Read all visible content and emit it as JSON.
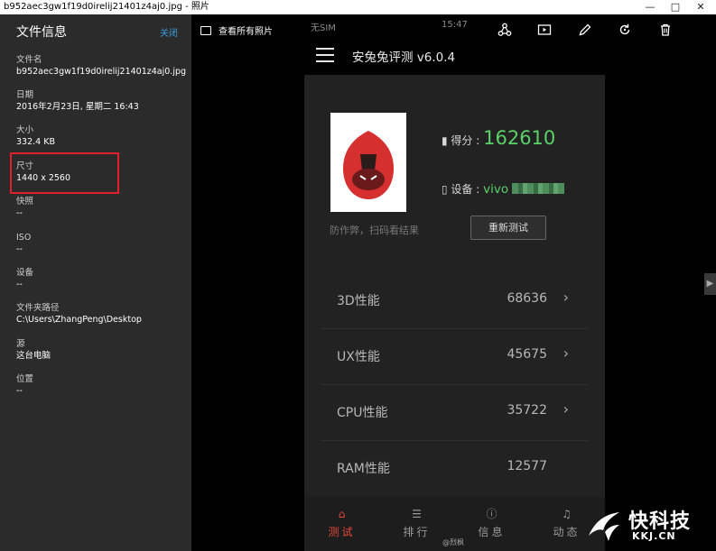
{
  "window": {
    "title": "b952aec3gw1f19d0irelij21401z4aj0.jpg - 照片"
  },
  "file_info": {
    "header": "文件信息",
    "close_label": "关闭",
    "fields": [
      {
        "label": "文件名",
        "value": "b952aec3gw1f19d0irelij21401z4aj0.jpg"
      },
      {
        "label": "日期",
        "value": "2016年2月23日, 星期二 16:43"
      },
      {
        "label": "大小",
        "value": "332.4 KB"
      },
      {
        "label": "尺寸",
        "value": "1440 x 2560"
      },
      {
        "label": "快照",
        "value": "--"
      },
      {
        "label": "ISO",
        "value": "--"
      },
      {
        "label": "设备",
        "value": "--"
      },
      {
        "label": "文件夹路径",
        "value": "C:\\Users\\ZhangPeng\\Desktop"
      },
      {
        "label": "源",
        "value": "这台电脑"
      },
      {
        "label": "位置",
        "value": "--"
      }
    ],
    "highlight_color": "#e0212b"
  },
  "toolbar": {
    "see_all_label": "查看所有照片",
    "icons": [
      "share-icon",
      "slideshow-icon",
      "edit-icon",
      "rotate-icon",
      "delete-icon"
    ]
  },
  "phone_status": {
    "carrier": "无SIM",
    "time": "15:47"
  },
  "app": {
    "title": "安兔兔评测 v6.0.4",
    "score_label": "得分 :",
    "score_value": "162610",
    "device_label": "设备 :",
    "device_value": "vivo",
    "anti_cheat": "防作弊，扫码看结果",
    "retest_label": "重新测试",
    "results": [
      {
        "name": "3D性能",
        "value": "68636"
      },
      {
        "name": "UX性能",
        "value": "45675"
      },
      {
        "name": "CPU性能",
        "value": "35722"
      },
      {
        "name": "RAM性能",
        "value": "12577"
      }
    ],
    "nav": [
      {
        "icon": "home-icon",
        "label": "测试",
        "active": true
      },
      {
        "icon": "list-icon",
        "label": "排行",
        "active": false
      },
      {
        "icon": "info-icon",
        "label": "信息",
        "active": false
      },
      {
        "icon": "bell-icon",
        "label": "动态",
        "active": false
      }
    ],
    "accent_color": "#e8473a",
    "score_color": "#5bd16a"
  },
  "credit": "@烈枫",
  "watermark": {
    "brand": "快科技",
    "domain": "KKJ.CN"
  }
}
